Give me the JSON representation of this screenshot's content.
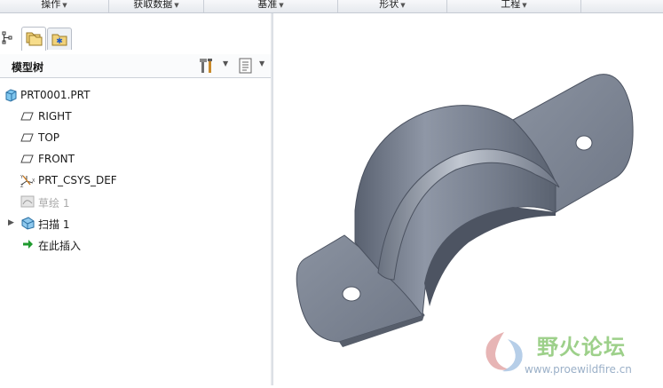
{
  "ribbon": {
    "groups": [
      "操作",
      "获取数据",
      "基准",
      "形状",
      "工程"
    ]
  },
  "model_tree": {
    "title": "模型树",
    "items": [
      {
        "label": "PRT0001.PRT",
        "icon": "part-icon"
      },
      {
        "label": "RIGHT",
        "icon": "datum-plane-icon"
      },
      {
        "label": "TOP",
        "icon": "datum-plane-icon"
      },
      {
        "label": "FRONT",
        "icon": "datum-plane-icon"
      },
      {
        "label": "PRT_CSYS_DEF",
        "icon": "coordinate-system-icon"
      },
      {
        "label": "草绘 1",
        "icon": "sketch-icon",
        "suppressed": true
      },
      {
        "label": "扫描 1",
        "icon": "sweep-feature-icon",
        "expandable": true
      },
      {
        "label": "在此插入",
        "icon": "insert-here-arrow-icon"
      }
    ]
  },
  "watermark": {
    "title": "野火论坛",
    "url": "www.proewildfire.cn"
  },
  "colors": {
    "part_surface": "#7b8392",
    "insert_arrow": "#1f9a2e",
    "watermark_green": "#9dd08a"
  }
}
